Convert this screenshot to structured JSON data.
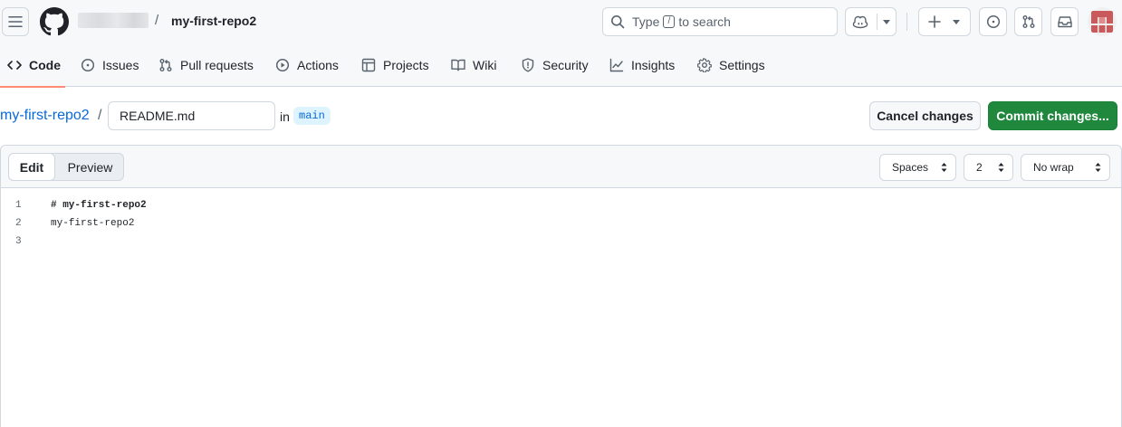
{
  "header": {
    "repo_name": "my-first-repo2",
    "slash": "/",
    "search": {
      "prefix": "Type",
      "key": "/",
      "suffix": "to search"
    }
  },
  "nav": {
    "tabs": [
      {
        "label": "Code",
        "icon": "code-icon"
      },
      {
        "label": "Issues",
        "icon": "issue-opened-icon"
      },
      {
        "label": "Pull requests",
        "icon": "git-pull-request-icon"
      },
      {
        "label": "Actions",
        "icon": "play-icon"
      },
      {
        "label": "Projects",
        "icon": "table-icon"
      },
      {
        "label": "Wiki",
        "icon": "book-icon"
      },
      {
        "label": "Security",
        "icon": "shield-icon"
      },
      {
        "label": "Insights",
        "icon": "graph-icon"
      },
      {
        "label": "Settings",
        "icon": "gear-icon"
      }
    ],
    "active": "Code"
  },
  "path": {
    "repo": "my-first-repo2",
    "separator": "/",
    "filename": "README.md",
    "in_label": "in",
    "branch": "main"
  },
  "actions": {
    "cancel": "Cancel changes",
    "commit": "Commit changes..."
  },
  "editor": {
    "mode_edit": "Edit",
    "mode_preview": "Preview",
    "indent_mode": "Spaces",
    "indent_size": "2",
    "wrap_mode": "No wrap",
    "lines": [
      {
        "number": "1",
        "text": "# my-first-repo2"
      },
      {
        "number": "2",
        "text": "my-first-repo2"
      },
      {
        "number": "3",
        "text": ""
      }
    ]
  },
  "colors": {
    "link": "#0969da",
    "commit_green": "#1f883d",
    "nav_underline": "#fd8c73",
    "branch_bg": "#ddf4ff"
  }
}
